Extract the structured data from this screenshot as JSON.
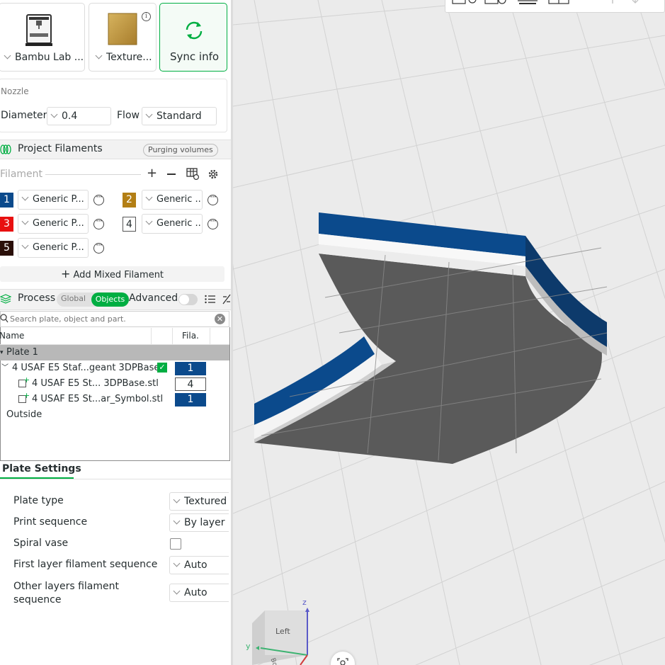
{
  "printer": {
    "name": "Bambu Lab ...",
    "plate_name": "Texture...",
    "sync_label": "Sync info"
  },
  "nozzle": {
    "section_label": "Nozzle",
    "diameter_label": "Diameter",
    "diameter_value": "0.4",
    "flow_label": "Flow",
    "flow_value": "Standard"
  },
  "filaments": {
    "title": "Project Filaments",
    "purging_label": "Purging volumes",
    "list_label": "Filament",
    "add_mixed_label": "Add Mixed Filament",
    "items": [
      {
        "index": "1",
        "name": "Generic P...",
        "color": "#0b4a8c"
      },
      {
        "index": "2",
        "name": "Generic ...",
        "color": "#b37f15"
      },
      {
        "index": "3",
        "name": "Generic P...",
        "color": "#e81010"
      },
      {
        "index": "4",
        "name": "Generic ...",
        "color": "#ffffff"
      },
      {
        "index": "5",
        "name": "Generic P...",
        "color": "#2a0f08"
      }
    ]
  },
  "process": {
    "title": "Process",
    "global_label": "Global",
    "objects_label": "Objects",
    "advanced_label": "Advanced"
  },
  "search": {
    "placeholder": "Search plate, object and part."
  },
  "tree": {
    "col_name": "Name",
    "col_fila": "Fila.",
    "plate_label": "Plate 1",
    "object_name": "4 USAF E5 Staf...geant 3DPBase",
    "object_fila": "1",
    "parts": [
      {
        "name": "4 USAF E5 St... 3DPBase.stl",
        "fila": "4"
      },
      {
        "name": "4 USAF E5 St...ar_Symbol.stl",
        "fila": "1"
      }
    ],
    "outside_label": "Outside"
  },
  "plate_settings": {
    "title": "Plate Settings",
    "rows": [
      {
        "label": "Plate type",
        "value": "Textured"
      },
      {
        "label": "Print sequence",
        "value": "By layer"
      },
      {
        "label": "Spiral vase",
        "value": ""
      },
      {
        "label": "First layer filament sequence",
        "value": "Auto"
      },
      {
        "label": "Other layers filament sequence",
        "value": "Auto"
      }
    ]
  },
  "viewport": {
    "cube_face": "Left",
    "axis_z": "z",
    "axis_y": "y",
    "cube_bottom": "Botto"
  },
  "colors": {
    "accent": "#00ae42",
    "model_blue": "#0b4a8c",
    "model_gray": "#5a5a5a"
  }
}
